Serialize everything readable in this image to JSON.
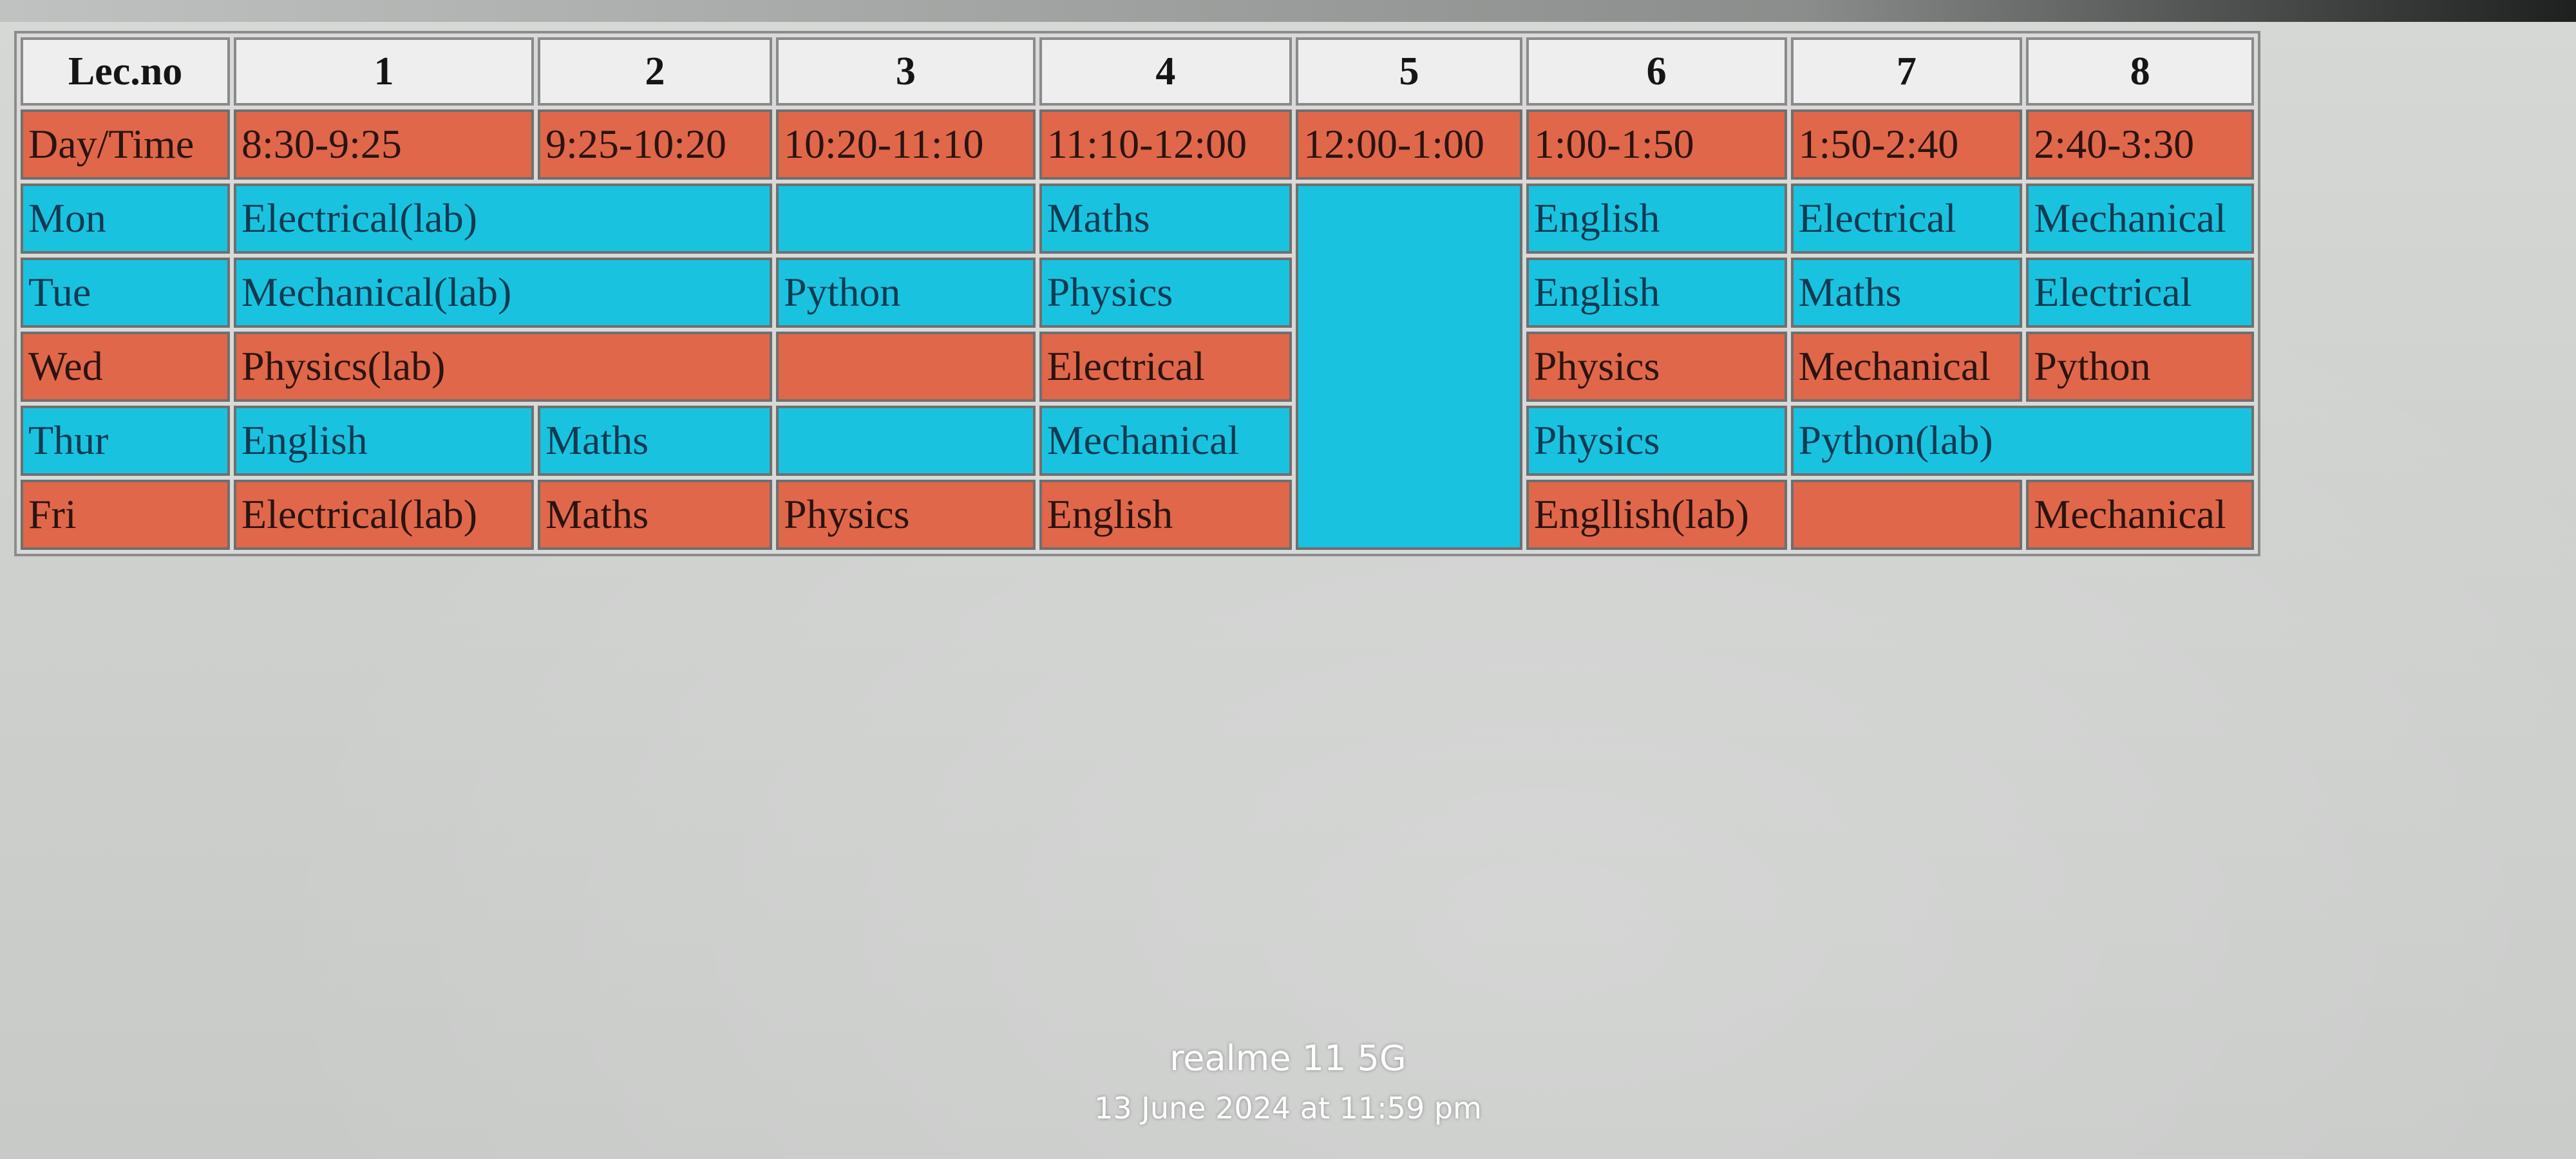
{
  "timetable": {
    "header": [
      "Lec.no",
      "1",
      "2",
      "3",
      "4",
      "5",
      "6",
      "7",
      "8"
    ],
    "times": [
      "Day/Time",
      "8:30-9:25",
      "9:25-10:20",
      "10:20-11:10",
      "11:10-12:00",
      "12:00-1:00",
      "1:00-1:50",
      "1:50-2:40",
      "2:40-3:30"
    ],
    "mon": {
      "day": "Mon",
      "s1": "Electrical(lab)",
      "s3": "",
      "s4": "Maths",
      "s6": "English",
      "s7": "Electrical",
      "s8": "Mechanical"
    },
    "tue": {
      "day": "Tue",
      "s1": "Mechanical(lab)",
      "s3": "Python",
      "s4": "Physics",
      "s6": "English",
      "s7": "Maths",
      "s8": "Electrical"
    },
    "wed": {
      "day": "Wed",
      "s1": "Physics(lab)",
      "s3": "",
      "s4": "Electrical",
      "s6": "Physics",
      "s7": "Mechanical",
      "s8": "Python"
    },
    "thur": {
      "day": "Thur",
      "s1": "English",
      "s2": "Maths",
      "s3": "",
      "s4": "Mechanical",
      "s6": "Physics",
      "s7": "Python(lab)"
    },
    "fri": {
      "day": "Fri",
      "s1": "Electrical(lab)",
      "s2": "Maths",
      "s3": "Physics",
      "s4": "English",
      "s6": "Engllish(lab)",
      "s7": "",
      "s8": "Mechanical"
    }
  },
  "colors": {
    "header_bg": "#eeeeee",
    "red_row": "#e0674a",
    "blue_row": "#19c3df"
  },
  "watermark": {
    "model": "realme 11 5G",
    "date": "13 June 2024 at 11:59 pm"
  }
}
